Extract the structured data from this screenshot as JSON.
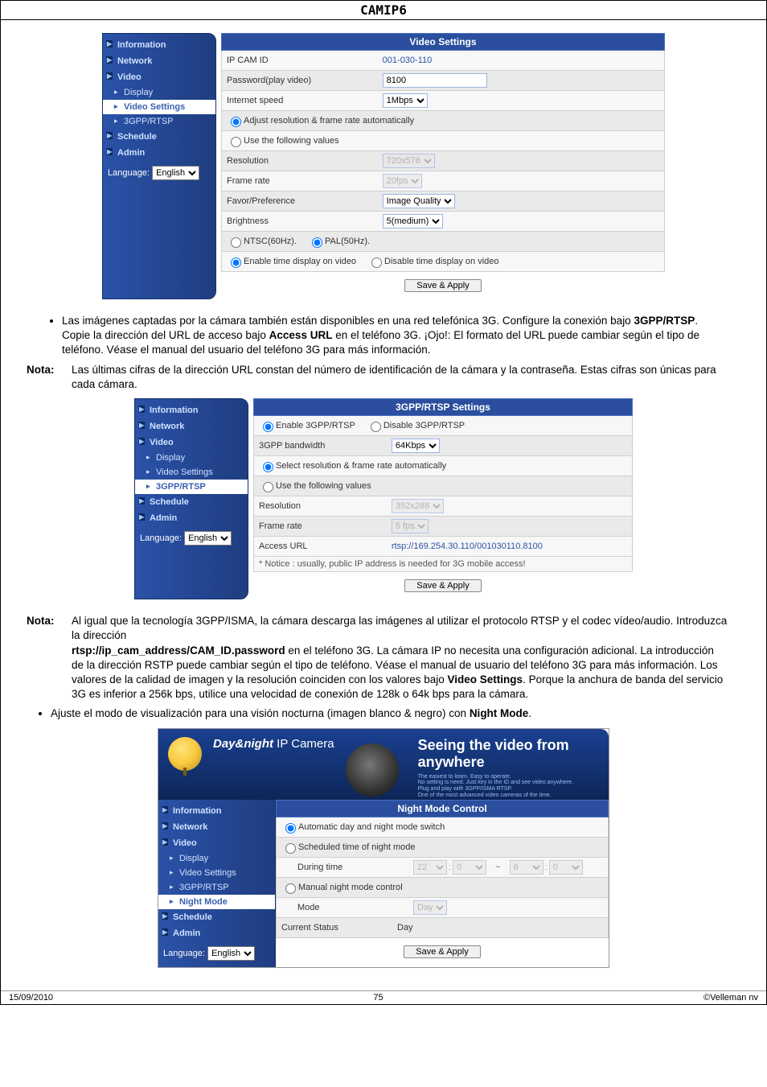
{
  "title": "CAMIP6",
  "video_settings": {
    "header": "Video Settings",
    "nav": {
      "information": "Information",
      "network": "Network",
      "video": "Video",
      "display": "Display",
      "video_settings": "Video Settings",
      "gpp": "3GPP/RTSP",
      "schedule": "Schedule",
      "admin": "Admin"
    },
    "language_label": "Language:",
    "language_value": "English",
    "rows": {
      "ip_cam_id_label": "IP CAM ID",
      "ip_cam_id_value": "001-030-110",
      "password_label": "Password(play video)",
      "password_value": "8100",
      "internet_speed_label": "Internet speed",
      "internet_speed_value": "1Mbps",
      "adjust_auto": "Adjust resolution & frame rate automatically",
      "use_following": "Use the following values",
      "resolution_label": "Resolution",
      "resolution_value": "720x576",
      "frame_rate_label": "Frame rate",
      "frame_rate_value": "20fps",
      "favor_label": "Favor/Preference",
      "favor_value": "Image Quality",
      "brightness_label": "Brightness",
      "brightness_value": "5(medium)",
      "ntsc": "NTSC(60Hz).",
      "pal": "PAL(50Hz).",
      "enable_time": "Enable time display on video",
      "disable_time": "Disable time display on video",
      "save_apply": "Save & Apply"
    }
  },
  "bullet1": "Las imágenes captadas por la cámara también están disponibles en una red telefónica 3G. Configure la conexión bajo ",
  "bullet1_b1": "3GPP/RTSP",
  "bullet1_mid": ". Copie la dirección del URL de acceso bajo ",
  "bullet1_b2": "Access URL",
  "bullet1_end": " en el teléfono 3G. ¡Ojo!: El formato del URL puede cambiar según el tipo de teléfono. Véase el manual del usuario del teléfono 3G para más información.",
  "nota1_label": "Nota:",
  "nota1_text": "Las últimas cifras de la dirección URL constan del número de identificación de la cámara y la contraseña. Estas cifras son únicas para cada cámara.",
  "gpp_settings": {
    "header": "3GPP/RTSP Settings",
    "enable": "Enable 3GPP/RTSP",
    "disable": "Disable 3GPP/RTSP",
    "bandwidth_label": "3GPP bandwidth",
    "bandwidth_value": "64Kbps",
    "select_auto": "Select resolution & frame rate automatically",
    "use_following": "Use the following values",
    "resolution_label": "Resolution",
    "resolution_value": "352x288",
    "frame_rate_label": "Frame rate",
    "frame_rate_value": "5 fps",
    "access_url_label": "Access URL",
    "access_url_value": "rtsp://169.254.30.110/001030110.8100",
    "notice": "* Notice : usually, public IP address is needed for 3G mobile access!",
    "save_apply": "Save & Apply"
  },
  "nota2_label": "Nota:",
  "nota2_p1": "Al igual que la tecnología 3GPP/ISMA, la cámara descarga las imágenes al utilizar el protocolo RTSP y el codec vídeo/audio. Introduzca la dirección",
  "nota2_rtsp": "rtsp://ip_cam_address/CAM_ID.password",
  "nota2_p2": " en el teléfono 3G. La cámara IP no necesita una configuración adicional. La introducción de la dirección RSTP puede cambiar según el tipo de teléfono. Véase el manual de usuario del teléfono 3G para más información. Los valores de la calidad de imagen y la resolución coinciden con los valores bajo ",
  "nota2_b1": "Video Settings",
  "nota2_p3": ". Porque la anchura de banda del servicio 3G es inferior a 256k bps, utilice una velocidad de conexión de 128k o 64k bps para la cámara.",
  "bullet2_pre": "Ajuste el modo de visualización para una visión nocturna (imagen blanco & negro) con ",
  "bullet2_b": "Night Mode",
  "bullet2_post": ".",
  "night": {
    "brand_pre": "Day&night",
    "brand_post": " IP Camera",
    "headline": "Seeing the video from anywhere",
    "header": "Night Mode Control",
    "auto": "Automatic day and night mode switch",
    "scheduled": "Scheduled time of night mode",
    "during_label": "During time",
    "h1": "22",
    "m1": "0",
    "h2": "6",
    "m2": "0",
    "manual": "Manual night mode control",
    "mode_label": "Mode",
    "mode_value": "Day",
    "current_label": "Current Status",
    "current_value": "Day",
    "save_apply": "Save & Apply",
    "nav": {
      "information": "Information",
      "network": "Network",
      "video": "Video",
      "display": "Display",
      "video_settings": "Video Settings",
      "gpp": "3GPP/RTSP",
      "night_mode": "Night Mode",
      "schedule": "Schedule",
      "admin": "Admin"
    }
  },
  "footer": {
    "left": "15/09/2010",
    "center": "75",
    "right": "©Velleman nv"
  }
}
